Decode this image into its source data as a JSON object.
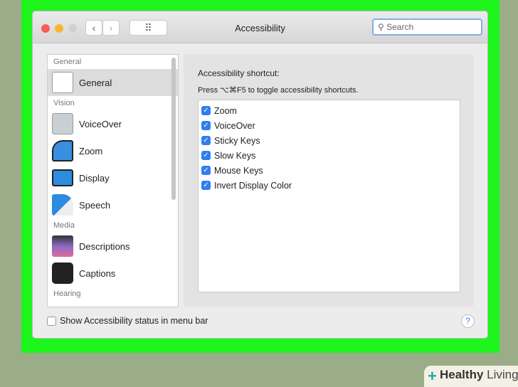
{
  "window": {
    "title": "Accessibility",
    "search_placeholder": "Search",
    "back": "‹",
    "forward": "›",
    "grid": "⠿"
  },
  "sidebar": {
    "sections": [
      {
        "label": "General",
        "items": [
          {
            "label": "General",
            "icon": "general-icon",
            "selected": true
          }
        ]
      },
      {
        "label": "Vision",
        "items": [
          {
            "label": "VoiceOver",
            "icon": "voiceover-icon"
          },
          {
            "label": "Zoom",
            "icon": "zoom-icon"
          },
          {
            "label": "Display",
            "icon": "display-icon"
          },
          {
            "label": "Speech",
            "icon": "speech-icon"
          }
        ]
      },
      {
        "label": "Media",
        "items": [
          {
            "label": "Descriptions",
            "icon": "descriptions-icon"
          },
          {
            "label": "Captions",
            "icon": "captions-icon"
          }
        ]
      },
      {
        "label": "Hearing",
        "items": []
      }
    ]
  },
  "main": {
    "heading": "Accessibility shortcut:",
    "subtitle": "Press ⌥⌘F5 to toggle accessibility shortcuts.",
    "options": [
      "Zoom",
      "VoiceOver",
      "Sticky Keys",
      "Slow Keys",
      "Mouse Keys",
      "Invert Display Color"
    ]
  },
  "footer": {
    "status_label": "Show Accessibility status in menu bar",
    "help": "?"
  },
  "watermark": {
    "bold": "Healthy",
    "light": "Living"
  },
  "colors": {
    "frame": "#1df51d",
    "accent": "#2f7ef2"
  }
}
